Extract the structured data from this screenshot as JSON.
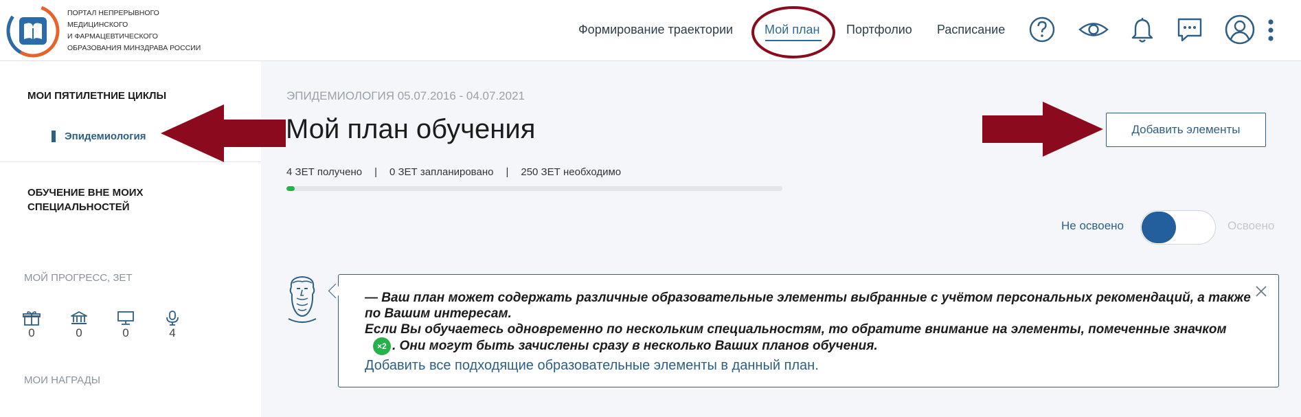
{
  "header": {
    "logo_text": [
      "ПОРТАЛ НЕПРЕРЫВНОГО",
      "МЕДИЦИНСКОГО",
      "И ФАРМАЦЕВТИЧЕСКОГО",
      "ОБРАЗОВАНИЯ МИНЗДРАВА РОССИИ"
    ],
    "nav": [
      "Формирование траектории",
      "Мой план",
      "Портфолио",
      "Расписание"
    ],
    "active_nav": "Мой план",
    "icons": [
      "help-icon",
      "eye-icon",
      "bell-icon",
      "chat-icon",
      "user-icon",
      "more-vertical-icon"
    ]
  },
  "sidebar": {
    "cycles_heading": "МОИ ПЯТИЛЕТНИЕ ЦИКЛЫ",
    "cycle_item": "Эпидемиология",
    "other_heading": "ОБУЧЕНИЕ ВНЕ МОИХ СПЕЦИАЛЬНОСТЕЙ",
    "progress_heading": "МОЙ ПРОГРЕСС, ЗЕТ",
    "progress": [
      {
        "icon": "gift-icon",
        "value": "0"
      },
      {
        "icon": "bank-icon",
        "value": "0"
      },
      {
        "icon": "monitor-icon",
        "value": "0"
      },
      {
        "icon": "microphone-icon",
        "value": "4"
      }
    ],
    "awards_heading": "МОИ НАГРАДЫ"
  },
  "main": {
    "breadcrumb": "ЭПИДЕМИОЛОГИЯ 05.07.2016 - 04.07.2021",
    "title": "Мой план обучения",
    "stat_received": "4 ЗЕТ получено",
    "stat_planned": "0 ЗЕТ запланировано",
    "stat_needed": "250 ЗЕТ необходимо",
    "progress_fraction": 0.016,
    "add_button": "Добавить элементы",
    "toggle_left": "Не освоено",
    "toggle_right": "Освоено",
    "hint_line1": "— Ваш план может содержать различные образовательные элементы выбранные с учётом персональных рекомендаций, а также по Вашим интересам.",
    "hint_line2": "Если Вы обучаетесь одновременно по нескольким специальностям, то обратите внимание на элементы, помеченные значком",
    "hint_badge": "×2",
    "hint_line3": ". Они могут быть зачислены сразу в несколько Ваших планов обучения.",
    "hint_link": "Добавить все подходящие образовательные элементы в данный план."
  },
  "colors": {
    "accent": "#2d5f85",
    "progress_green": "#27b14a",
    "annotation_red": "#8b0a1e",
    "toggle_knob": "#225f9c"
  }
}
